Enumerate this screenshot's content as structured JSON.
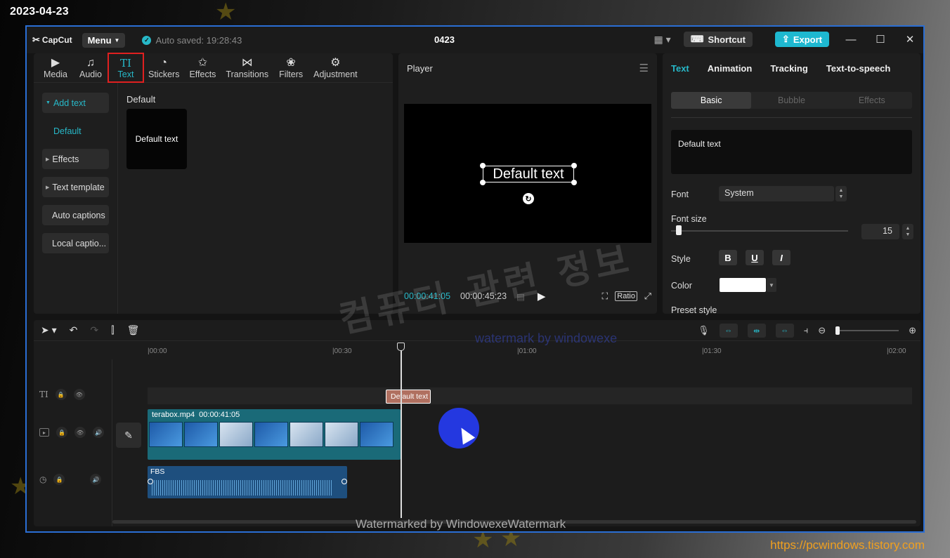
{
  "overlay": {
    "date": "2023-04-23",
    "site_url": "https://pcwindows.tistory.com",
    "watermark_korean": "컴퓨터 관련 정보",
    "watermark_faint": "watermark by windowexe",
    "watermark_bottom": "Watermarked by WindowexeWatermark"
  },
  "titlebar": {
    "logo": "CapCut",
    "menu_label": "Menu",
    "autosave_text": "Auto saved: 19:28:43",
    "project_title": "0423",
    "shortcut_label": "Shortcut",
    "export_label": "Export"
  },
  "toolbar_tabs": [
    {
      "label": "Media",
      "icon": "media-icon",
      "glyph": "▶"
    },
    {
      "label": "Audio",
      "icon": "audio-icon",
      "glyph": "♫"
    },
    {
      "label": "Text",
      "icon": "text-icon",
      "glyph": "TI"
    },
    {
      "label": "Stickers",
      "icon": "stickers-icon",
      "glyph": "◔"
    },
    {
      "label": "Effects",
      "icon": "effects-icon",
      "glyph": "✩"
    },
    {
      "label": "Transitions",
      "icon": "transitions-icon",
      "glyph": "⋈"
    },
    {
      "label": "Filters",
      "icon": "filters-icon",
      "glyph": "❀"
    },
    {
      "label": "Adjustment",
      "icon": "adjustment-icon",
      "glyph": "⚙"
    }
  ],
  "text_sidebar": {
    "add_text": "Add text",
    "default": "Default",
    "effects": "Effects",
    "text_template": "Text template",
    "auto_captions": "Auto captions",
    "local_captions": "Local captio..."
  },
  "text_library": {
    "section": "Default",
    "preset_label": "Default text"
  },
  "player": {
    "title": "Player",
    "overlay_text": "Default text",
    "current_time": "00:00:41:05",
    "total_time": "00:00:45:23",
    "ratio_label": "Ratio"
  },
  "inspector": {
    "tabs": [
      "Text",
      "Animation",
      "Tracking",
      "Text-to-speech"
    ],
    "subtabs": [
      "Basic",
      "Bubble",
      "Effects"
    ],
    "text_value": "Default text",
    "font_label": "Font",
    "font_value": "System",
    "font_size_label": "Font size",
    "font_size_value": "15",
    "style_label": "Style",
    "color_label": "Color",
    "color_value": "#ffffff",
    "preset_style_label": "Preset style"
  },
  "timeline": {
    "ruler": [
      "|00:00",
      "|00:30",
      "|01:00",
      "|01:30",
      "|02:00"
    ],
    "text_clip": "Default text",
    "video_clip_name": "terabox.mp4",
    "video_clip_duration": "00:00:41:05",
    "audio_clip_name": "FBS"
  },
  "colors": {
    "accent": "#27b8c8",
    "export": "#1eb8d0",
    "frame": "#2a6ed4",
    "highlight": "#e02020"
  }
}
